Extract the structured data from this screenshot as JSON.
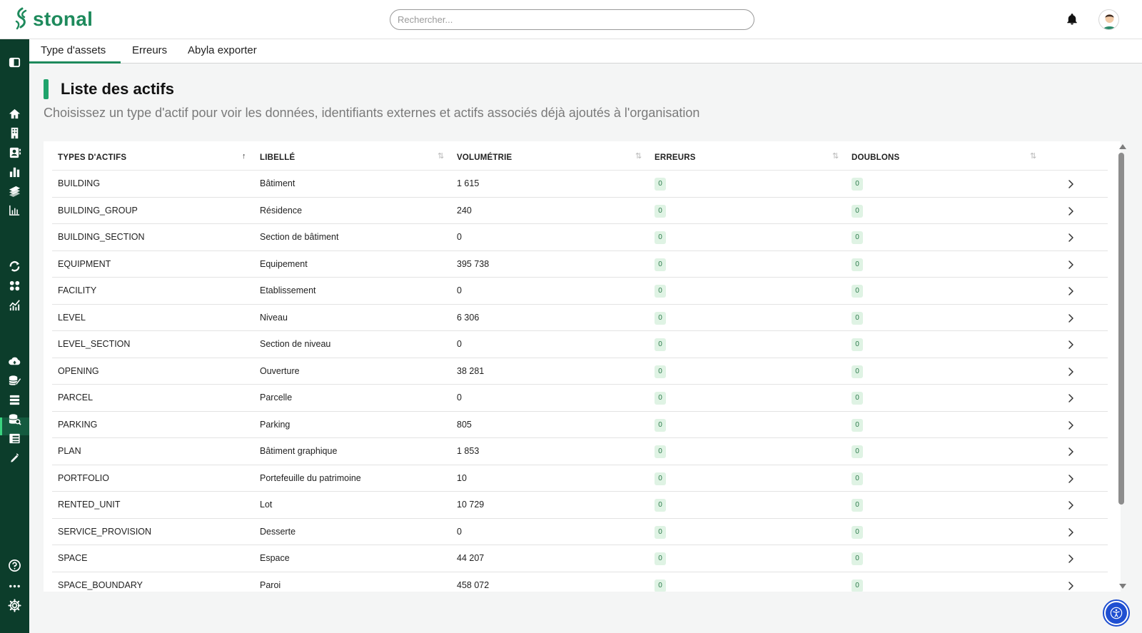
{
  "app": {
    "logo_text": "stonal",
    "brand_color": "#1e8a5c",
    "sidebar_color": "#0c3d2b"
  },
  "search": {
    "placeholder": "Rechercher..."
  },
  "header_icons": [
    "bell-icon",
    "user-avatar"
  ],
  "sidebar": {
    "icons": [
      "sidebar-toggle-icon",
      "home-icon",
      "building-icon",
      "contact-card-icon",
      "bar-chart-icon",
      "layers-icon",
      "analytics-chart-icon",
      "refresh-icon",
      "apps-grid-icon",
      "trend-chart-icon",
      "cloud-upload-icon",
      "database-edit-icon",
      "list-icon",
      "database-search-icon",
      "table-icon",
      "pen-icon",
      "help-icon",
      "more-icon",
      "settings-icon"
    ],
    "active": "database-edit-icon"
  },
  "tabs": [
    {
      "label": "Type d'assets",
      "active": true
    },
    {
      "label": "Erreurs",
      "active": false
    },
    {
      "label": "Abyla exporter",
      "active": false
    }
  ],
  "page": {
    "title": "Liste des actifs",
    "subtitle": "Choisissez un type d'actif pour voir les données, identifiants externes et actifs associés déjà ajoutés à l'organisation"
  },
  "table": {
    "columns": [
      "TYPES D'ACTIFS",
      "LIBELLÉ",
      "VOLUMÉTRIE",
      "ERREURS",
      "DOUBLONS"
    ],
    "sorted_column": "TYPES D'ACTIFS",
    "rows": [
      {
        "type": "BUILDING",
        "label": "Bâtiment",
        "volume": "1 615",
        "errors": "0",
        "duplicates": "0"
      },
      {
        "type": "BUILDING_GROUP",
        "label": "Résidence",
        "volume": "240",
        "errors": "0",
        "duplicates": "0"
      },
      {
        "type": "BUILDING_SECTION",
        "label": "Section de bâtiment",
        "volume": "0",
        "errors": "0",
        "duplicates": "0"
      },
      {
        "type": "EQUIPMENT",
        "label": "Equipement",
        "volume": "395 738",
        "errors": "0",
        "duplicates": "0"
      },
      {
        "type": "FACILITY",
        "label": "Etablissement",
        "volume": "0",
        "errors": "0",
        "duplicates": "0"
      },
      {
        "type": "LEVEL",
        "label": "Niveau",
        "volume": "6 306",
        "errors": "0",
        "duplicates": "0"
      },
      {
        "type": "LEVEL_SECTION",
        "label": "Section de niveau",
        "volume": "0",
        "errors": "0",
        "duplicates": "0"
      },
      {
        "type": "OPENING",
        "label": "Ouverture",
        "volume": "38 281",
        "errors": "0",
        "duplicates": "0"
      },
      {
        "type": "PARCEL",
        "label": "Parcelle",
        "volume": "0",
        "errors": "0",
        "duplicates": "0"
      },
      {
        "type": "PARKING",
        "label": "Parking",
        "volume": "805",
        "errors": "0",
        "duplicates": "0"
      },
      {
        "type": "PLAN",
        "label": "Bâtiment graphique",
        "volume": "1 853",
        "errors": "0",
        "duplicates": "0"
      },
      {
        "type": "PORTFOLIO",
        "label": "Portefeuille du patrimoine",
        "volume": "10",
        "errors": "0",
        "duplicates": "0"
      },
      {
        "type": "RENTED_UNIT",
        "label": "Lot",
        "volume": "10 729",
        "errors": "0",
        "duplicates": "0"
      },
      {
        "type": "SERVICE_PROVISION",
        "label": "Desserte",
        "volume": "0",
        "errors": "0",
        "duplicates": "0"
      },
      {
        "type": "SPACE",
        "label": "Espace",
        "volume": "44 207",
        "errors": "0",
        "duplicates": "0"
      },
      {
        "type": "SPACE_BOUNDARY",
        "label": "Paroi",
        "volume": "458 072",
        "errors": "0",
        "duplicates": "0"
      }
    ]
  },
  "accessibility_button": {
    "icon": "accessibility-icon",
    "color": "#1f4fd1"
  }
}
